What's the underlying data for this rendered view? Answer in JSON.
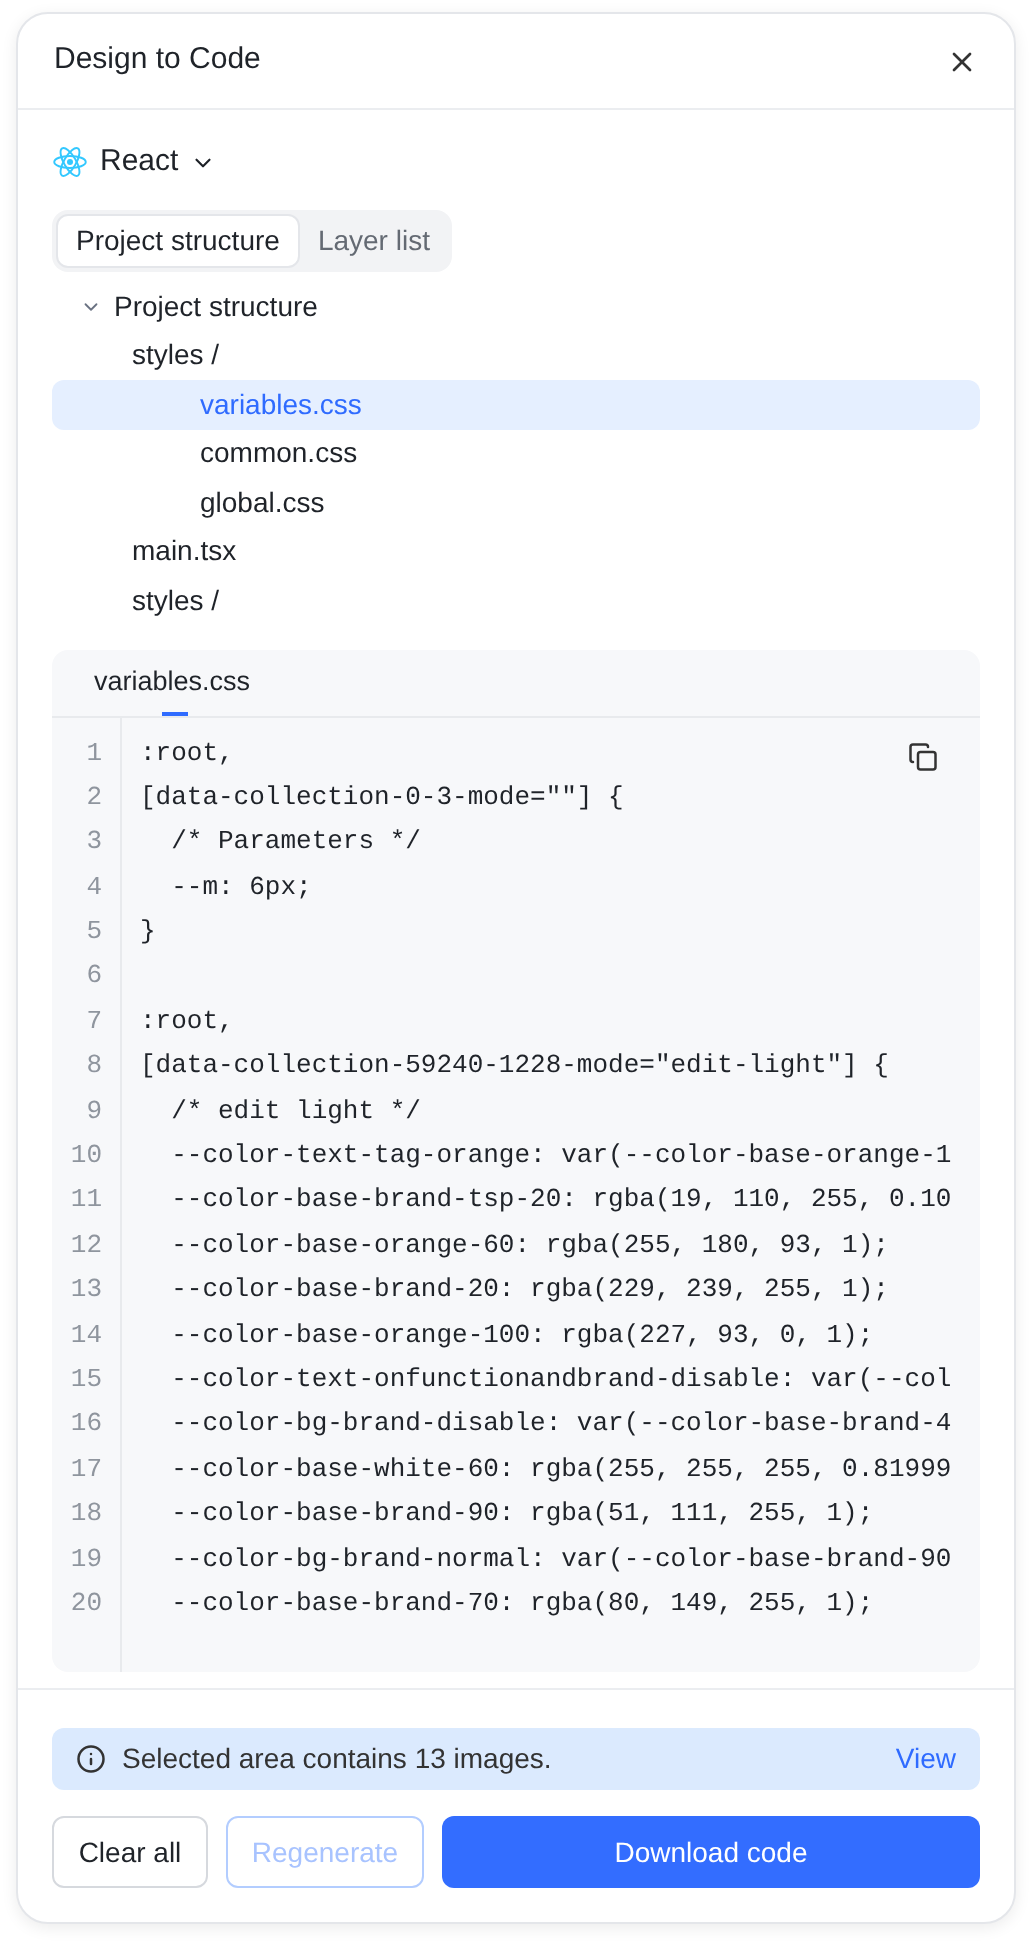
{
  "window": {
    "title": "Design to Code"
  },
  "framework": {
    "label": "React"
  },
  "tabs": [
    {
      "label": "Project structure",
      "selected": true
    },
    {
      "label": "Layer list",
      "selected": false
    }
  ],
  "tree": [
    {
      "label": "Project structure",
      "expanded": true,
      "selected": false,
      "children": [
        {
          "label": "styles /",
          "selected": false,
          "children": [
            {
              "label": "variables.css",
              "selected": true
            },
            {
              "label": "common.css",
              "selected": false
            },
            {
              "label": "global.css",
              "selected": false
            }
          ]
        },
        {
          "label": "main.tsx",
          "selected": false
        },
        {
          "label": "styles /",
          "selected": false
        }
      ]
    }
  ],
  "code_panel": {
    "tab": "variables.css",
    "lines": [
      {
        "number": "1",
        "text": ":root,"
      },
      {
        "number": "2",
        "text": "[data-collection-0-3-mode=\"\"] {"
      },
      {
        "number": "3",
        "text": "  /* Parameters */"
      },
      {
        "number": "4",
        "text": "  --m: 6px;"
      },
      {
        "number": "5",
        "text": "}"
      },
      {
        "number": "6"
      },
      {
        "number": "7",
        "text": ":root,"
      },
      {
        "number": "8",
        "text": "[data-collection-59240-1228-mode=\"edit-light\"] {"
      },
      {
        "number": "9",
        "text": "  /* edit light */"
      },
      {
        "number": "10",
        "text": "  --color-text-tag-orange: var(--color-base-orange-1"
      },
      {
        "number": "11",
        "text": "  --color-base-brand-tsp-20: rgba(19, 110, 255, 0.10"
      },
      {
        "number": "12",
        "text": "  --color-base-orange-60: rgba(255, 180, 93, 1);"
      },
      {
        "number": "13",
        "text": "  --color-base-brand-20: rgba(229, 239, 255, 1);"
      },
      {
        "number": "14",
        "text": "  --color-base-orange-100: rgba(227, 93, 0, 1);"
      },
      {
        "number": "15",
        "text": "  --color-text-onfunctionandbrand-disable: var(--col"
      },
      {
        "number": "16",
        "text": "  --color-bg-brand-disable: var(--color-base-brand-4"
      },
      {
        "number": "17",
        "text": "  --color-base-white-60: rgba(255, 255, 255, 0.81999"
      },
      {
        "number": "18",
        "text": "  --color-base-brand-90: rgba(51, 111, 255, 1);"
      },
      {
        "number": "19",
        "text": "  --color-bg-brand-normal: var(--color-base-brand-90"
      },
      {
        "number": "20",
        "text": "  --color-base-brand-70: rgba(80, 149, 255, 1);"
      }
    ]
  },
  "notice": {
    "text": "Selected area contains 13 images.",
    "link": "View"
  },
  "buttons": [
    {
      "label": "Clear all",
      "kind": "secondary",
      "disabled": false
    },
    {
      "label": "Regenerate",
      "kind": "secondary",
      "disabled": true
    },
    {
      "label": "Download code",
      "kind": "primary",
      "disabled": false
    }
  ]
}
